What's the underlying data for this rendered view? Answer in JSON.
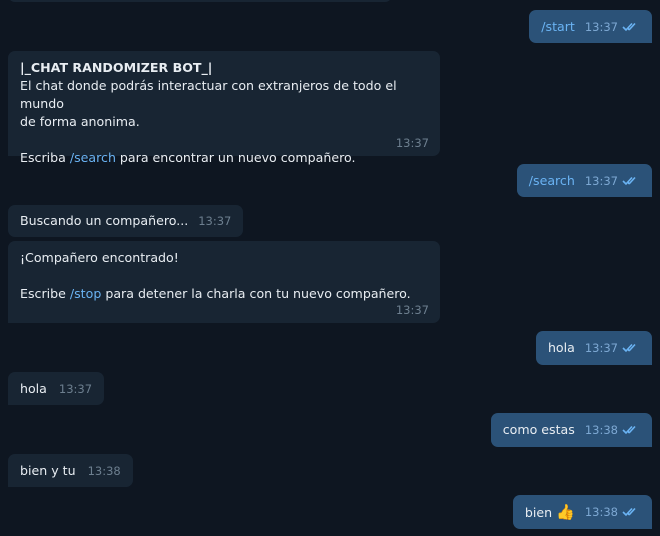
{
  "messages": [
    {
      "id": "start",
      "dir": "out",
      "text": "/start",
      "is_command": true,
      "time": "13:37",
      "status": "read"
    },
    {
      "id": "welcome",
      "dir": "in",
      "title": "|_CHAT RANDOMIZER BOT_|",
      "line1": "El chat donde podrás interactuar con extranjeros de todo el mundo",
      "line2": "de forma anonima.",
      "line3_pre": "Escriba ",
      "line3_cmd": "/search",
      "line3_post": " para encontrar un nuevo compañero.",
      "time": "13:37"
    },
    {
      "id": "search",
      "dir": "out",
      "text": "/search",
      "is_command": true,
      "time": "13:37",
      "status": "read"
    },
    {
      "id": "searching",
      "dir": "in",
      "text": "Buscando un compañero...",
      "time": "13:37"
    },
    {
      "id": "found",
      "dir": "in",
      "line1": "¡Compañero encontrado!",
      "line2_pre": "Escribe ",
      "line2_cmd": "/stop",
      "line2_post": " para detener la charla con tu nuevo compañero.",
      "time": "13:37"
    },
    {
      "id": "hola-out",
      "dir": "out",
      "text": "hola",
      "time": "13:37",
      "status": "read"
    },
    {
      "id": "hola-in",
      "dir": "in",
      "text": "hola",
      "time": "13:37"
    },
    {
      "id": "comoestas",
      "dir": "out",
      "text": "como estas",
      "time": "13:38",
      "status": "read"
    },
    {
      "id": "bienytu",
      "dir": "in",
      "text": "bien y tu",
      "time": "13:38"
    },
    {
      "id": "bien",
      "dir": "out",
      "text": "bien",
      "emoji": "👍",
      "time": "13:38",
      "status": "read"
    }
  ],
  "colors": {
    "background": "#0e1621",
    "incoming_bubble": "#182533",
    "outgoing_bubble": "#2b5278",
    "link": "#6ab3f3",
    "read_check": "#6ab3f3"
  },
  "icons": {
    "read_status": "double-check-icon"
  }
}
